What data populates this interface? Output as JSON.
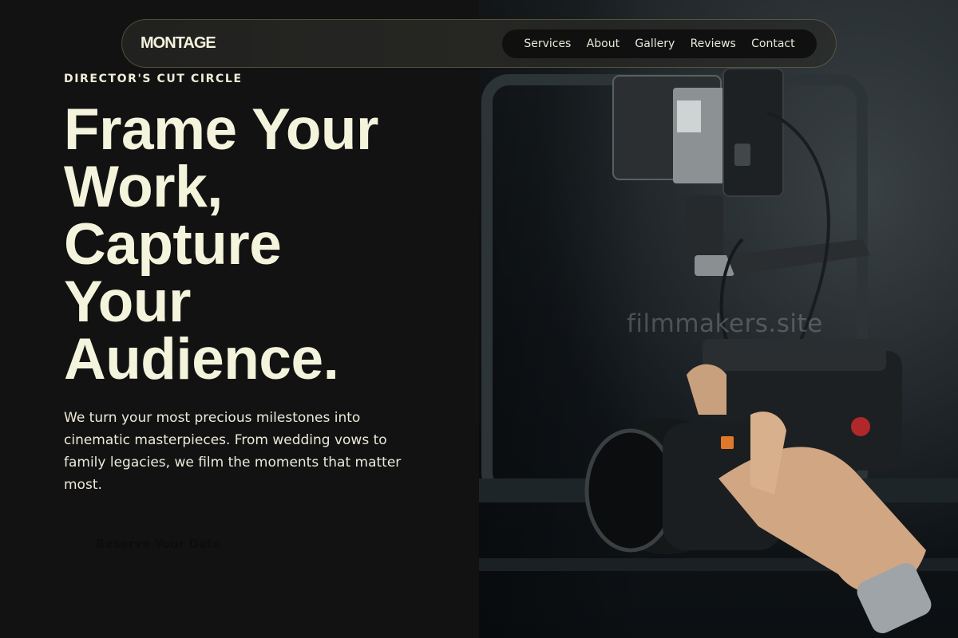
{
  "brand": {
    "logo": "MONTAGE"
  },
  "nav": {
    "items": [
      {
        "label": "Services"
      },
      {
        "label": "About"
      },
      {
        "label": "Gallery"
      },
      {
        "label": "Reviews"
      },
      {
        "label": "Contact"
      }
    ]
  },
  "hero": {
    "eyebrow": "DIRECTOR'S CUT CIRCLE",
    "headline_lines": [
      "Frame Your",
      "Work,",
      "Capture",
      "Your",
      "Audience."
    ],
    "description": "We turn your most precious milestones into cinematic masterpieces. From wedding vows to family legacies, we film the moments that matter most.",
    "cta_label": "Reserve Your Date"
  },
  "photo": {
    "watermark": "filmmakers.site",
    "subject": "camera-rig-photo"
  },
  "colors": {
    "background": "#121212",
    "text": "#f4f3dc",
    "nav_pill": "#0e0e0e",
    "lens_badge": "#e0782b"
  }
}
